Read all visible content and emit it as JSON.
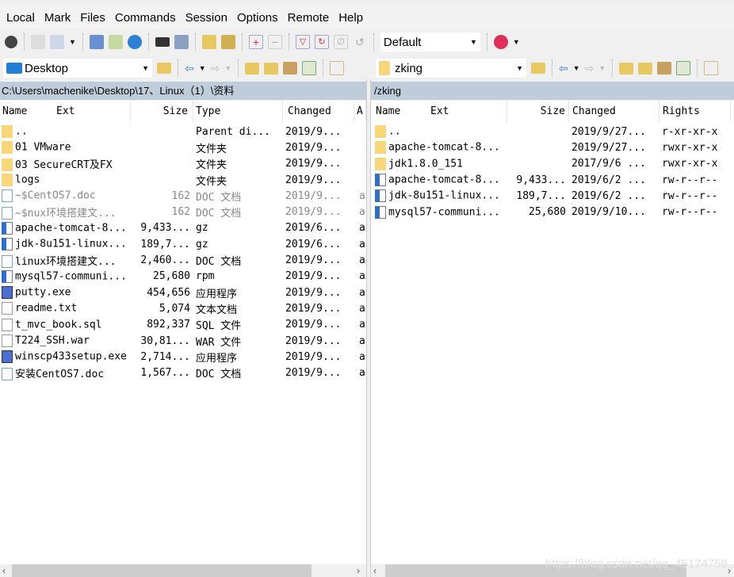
{
  "menu": [
    "Local",
    "Mark",
    "Files",
    "Commands",
    "Session",
    "Options",
    "Remote",
    "Help"
  ],
  "toolbar": {
    "transfer_settings": "Default"
  },
  "left": {
    "location": "Desktop",
    "path": "C:\\Users\\machenike\\Desktop\\17、Linux（1）\\资料",
    "columns": [
      "Name",
      "Ext",
      "Size",
      "Type",
      "Changed",
      "A"
    ],
    "rows": [
      {
        "icon": "parent",
        "name": "..",
        "size": "",
        "type": "Parent di...",
        "changed": "2019/9...",
        "attr": ""
      },
      {
        "icon": "folder",
        "name": "01 VMware",
        "size": "",
        "type": "文件夹",
        "changed": "2019/9...",
        "attr": ""
      },
      {
        "icon": "folder",
        "name": "03 SecureCRT及FX",
        "size": "",
        "type": "文件夹",
        "changed": "2019/9...",
        "attr": ""
      },
      {
        "icon": "folder",
        "name": "logs",
        "size": "",
        "type": "文件夹",
        "changed": "2019/9...",
        "attr": ""
      },
      {
        "icon": "doc",
        "name": "~$CentOS7.doc",
        "size": "162",
        "type": "DOC 文档",
        "changed": "2019/9...",
        "attr": "a",
        "hidden": true
      },
      {
        "icon": "doc",
        "name": "~$nux环境搭建文...",
        "size": "162",
        "type": "DOC 文档",
        "changed": "2019/9...",
        "attr": "a",
        "hidden": true
      },
      {
        "icon": "pkg",
        "name": "apache-tomcat-8...",
        "size": "9,433...",
        "type": "gz",
        "changed": "2019/6...",
        "attr": "a"
      },
      {
        "icon": "pkg",
        "name": "jdk-8u151-linux...",
        "size": "189,7...",
        "type": "gz",
        "changed": "2019/6...",
        "attr": "a"
      },
      {
        "icon": "doc",
        "name": "linux环境搭建文...",
        "size": "2,460...",
        "type": "DOC 文档",
        "changed": "2019/9...",
        "attr": "a"
      },
      {
        "icon": "pkg",
        "name": "mysql57-communi...",
        "size": "25,680",
        "type": "rpm",
        "changed": "2019/9...",
        "attr": "a"
      },
      {
        "icon": "exe",
        "name": "putty.exe",
        "size": "454,656",
        "type": "应用程序",
        "changed": "2019/9...",
        "attr": "a"
      },
      {
        "icon": "txt",
        "name": "readme.txt",
        "size": "5,074",
        "type": "文本文档",
        "changed": "2019/9...",
        "attr": "a"
      },
      {
        "icon": "txt",
        "name": "t_mvc_book.sql",
        "size": "892,337",
        "type": "SQL 文件",
        "changed": "2019/9...",
        "attr": "a"
      },
      {
        "icon": "txt",
        "name": "T224_SSH.war",
        "size": "30,81...",
        "type": "WAR 文件",
        "changed": "2019/9...",
        "attr": "a"
      },
      {
        "icon": "exe",
        "name": "winscp433setup.exe",
        "size": "2,714...",
        "type": "应用程序",
        "changed": "2019/9...",
        "attr": "a"
      },
      {
        "icon": "doc",
        "name": "安装CentOS7.doc",
        "size": "1,567...",
        "type": "DOC 文档",
        "changed": "2019/9...",
        "attr": "a"
      }
    ]
  },
  "right": {
    "location": "zking",
    "path": "/zking",
    "columns": [
      "Name",
      "Ext",
      "Size",
      "Changed",
      "Rights"
    ],
    "rows": [
      {
        "icon": "parent",
        "name": "..",
        "size": "",
        "changed": "2019/9/27...",
        "rights": "r-xr-xr-x"
      },
      {
        "icon": "folder",
        "name": "apache-tomcat-8...",
        "size": "",
        "changed": "2019/9/27...",
        "rights": "rwxr-xr-x"
      },
      {
        "icon": "folder",
        "name": "jdk1.8.0_151",
        "size": "",
        "changed": "2017/9/6 ...",
        "rights": "rwxr-xr-x"
      },
      {
        "icon": "pkg",
        "name": "apache-tomcat-8...",
        "size": "9,433...",
        "changed": "2019/6/2 ...",
        "rights": "rw-r--r--"
      },
      {
        "icon": "pkg",
        "name": "jdk-8u151-linux...",
        "size": "189,7...",
        "changed": "2019/6/2 ...",
        "rights": "rw-r--r--"
      },
      {
        "icon": "pkg",
        "name": "mysql57-communi...",
        "size": "25,680",
        "changed": "2019/9/10...",
        "rights": "rw-r--r--"
      }
    ]
  },
  "watermark": "https://blog.csdn.net/qq_45174759"
}
